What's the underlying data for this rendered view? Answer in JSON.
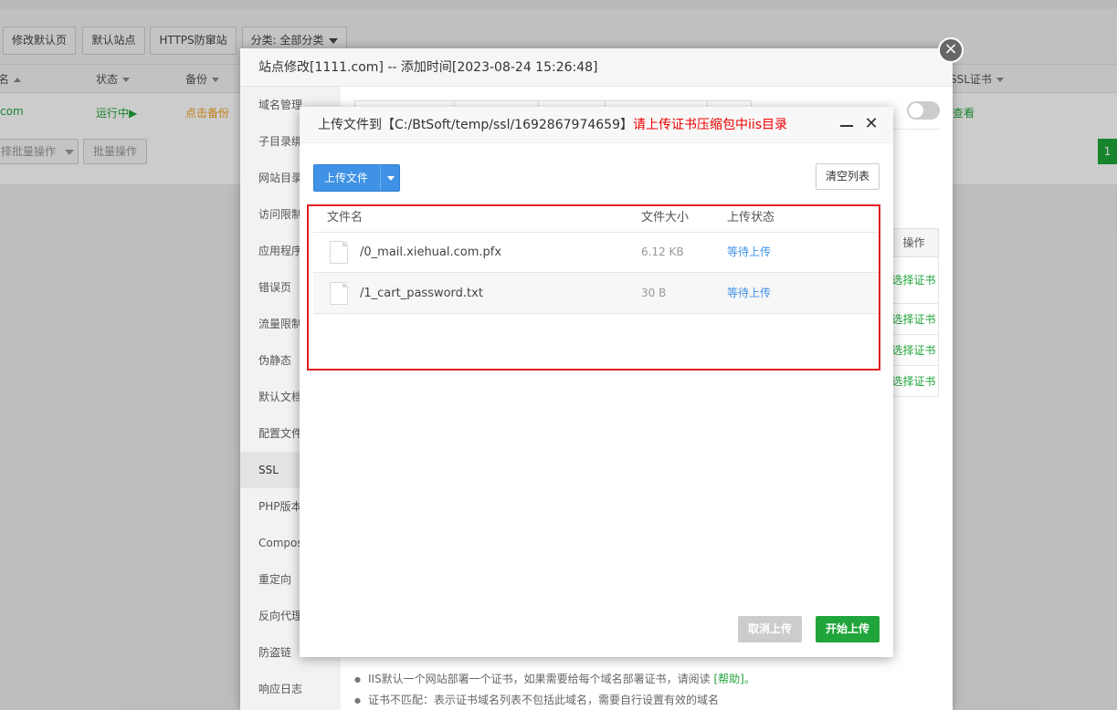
{
  "toolbar": {
    "edit_default_page": "修改默认页",
    "default_site": "默认站点",
    "https_firewall": "HTTPS防窜站",
    "category_filter": "分类: 全部分类"
  },
  "site_table": {
    "headers": [
      "名",
      "状态",
      "备份",
      "SSL证书"
    ],
    "row": {
      "domain": "com",
      "status": "运行中▶",
      "backup": "点击备份",
      "ssl": "查看"
    },
    "batch_select": "择批量操作",
    "batch_button": "批量操作",
    "page": "1"
  },
  "site_modal": {
    "title": "站点修改[1111.com] -- 添加时间[2023-08-24 15:26:48]",
    "close_icon": "close-icon",
    "menu": [
      "域名管理",
      "子目录绑",
      "网站目录",
      "访问限制",
      "应用程序",
      "错误页",
      "流量限制",
      "伪静态",
      "默认文档",
      "配置文件",
      "SSL",
      "PHP版本",
      "Compos",
      "重定向",
      "反向代理",
      "防盗链",
      "响应日志"
    ],
    "active_menu": "SSL",
    "ssl_op_header": "操作",
    "ssl_op_cells": [
      "选择证书",
      "选择证书",
      "选择证书",
      "选择证书"
    ],
    "tips": [
      {
        "text": "IIS默认一个网站部署一个证书，如果需要给每个域名部署证书，请阅读 ",
        "help": "[帮助]。"
      },
      {
        "text": "证书不匹配：表示证书域名列表不包括此域名，需要自行设置有效的域名",
        "help": ""
      }
    ]
  },
  "upload_dialog": {
    "title_prefix": "上传文件到【C:/BtSoft/temp/ssl/1692867974659】",
    "title_warning": "请上传证书压缩包中iis目录",
    "upload_button": "上传文件",
    "clear_button": "清空列表",
    "columns": {
      "name": "文件名",
      "size": "文件大小",
      "status": "上传状态"
    },
    "files": [
      {
        "name": "/0_mail.xiehual.com.pfx",
        "size": "6.12 KB",
        "status": "等待上传"
      },
      {
        "name": "/1_cart_password.txt",
        "size": "30 B",
        "status": "等待上传"
      }
    ],
    "cancel_button": "取消上传",
    "start_button": "开始上传"
  },
  "colors": {
    "primary_blue": "#3f92e6",
    "success_green": "#20a53a",
    "warning_red": "#e00000",
    "highlight_red": "#e02020"
  }
}
